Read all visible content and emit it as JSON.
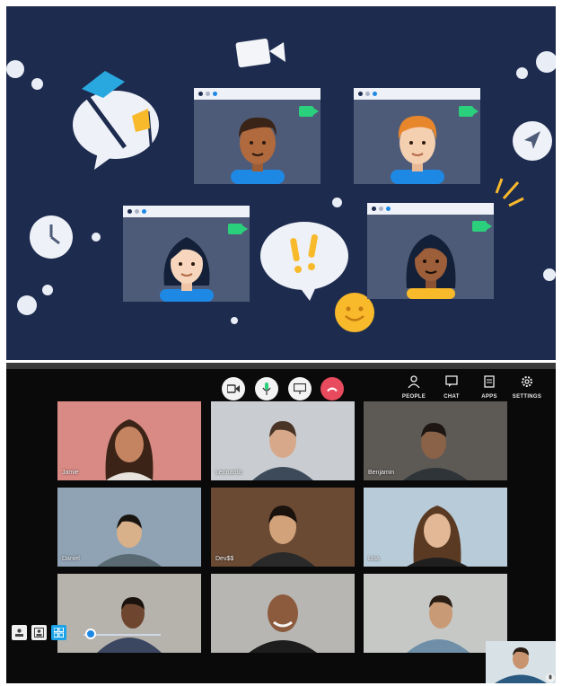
{
  "controls": {
    "video": "video-camera",
    "mic": "microphone",
    "screen": "screen-share",
    "end": "end-call"
  },
  "right_toolbar": [
    {
      "icon": "people-icon",
      "label": "PEOPLE"
    },
    {
      "icon": "chat-icon",
      "label": "CHAT"
    },
    {
      "icon": "apps-icon",
      "label": "APPS"
    },
    {
      "icon": "gear-icon",
      "label": "SETTINGS"
    }
  ],
  "participants": [
    {
      "name": "Jamie",
      "bg": "#d98a84"
    },
    {
      "name": "Leonardo",
      "bg": "#c9ccd1"
    },
    {
      "name": "Benjamin",
      "bg": "#5d5a55"
    },
    {
      "name": "Daniel",
      "bg": "#8fa3b5"
    },
    {
      "name": "Dev$$",
      "bg": "#6b4a34"
    },
    {
      "name": "Lisa",
      "bg": "#b8cbd9"
    },
    {
      "name": "",
      "bg": "#b6b2ac"
    },
    {
      "name": "",
      "bg": "#b7b6b3"
    },
    {
      "name": "",
      "bg": "#c5c8c5"
    }
  ],
  "colors": {
    "illustration_bg": "#1d2b4f",
    "accent_green": "#2bd07c",
    "end_call": "#e84b5e",
    "active_blue": "#1aa3e8"
  }
}
